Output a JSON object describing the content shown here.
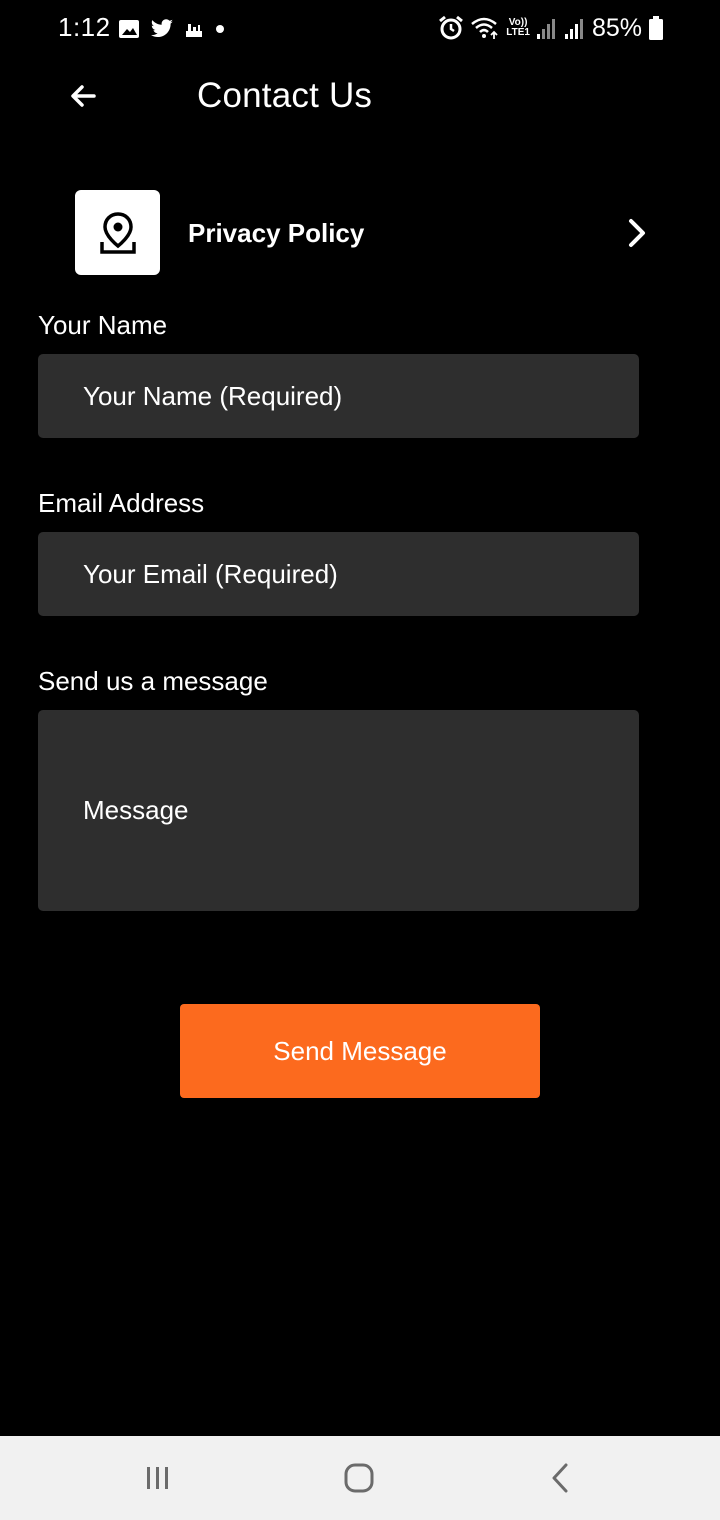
{
  "status_bar": {
    "time": "1:12",
    "battery": "85%",
    "volte_top": "Vo))",
    "volte_bottom": "LTE1"
  },
  "app_bar": {
    "title": "Contact Us"
  },
  "privacy": {
    "label": "Privacy Policy"
  },
  "form": {
    "name_label": "Your Name",
    "name_placeholder": "Your Name (Required)",
    "email_label": "Email Address",
    "email_placeholder": "Your Email (Required)",
    "message_label": "Send us a message",
    "message_placeholder": "Message",
    "send_label": "Send Message"
  },
  "colors": {
    "accent": "#fc6a1e",
    "field_bg": "#2e2e2e",
    "background": "#000000"
  },
  "icons": {
    "back": "arrow-left-icon",
    "privacy": "location-pin-icon",
    "chevron": "chevron-right-icon"
  }
}
